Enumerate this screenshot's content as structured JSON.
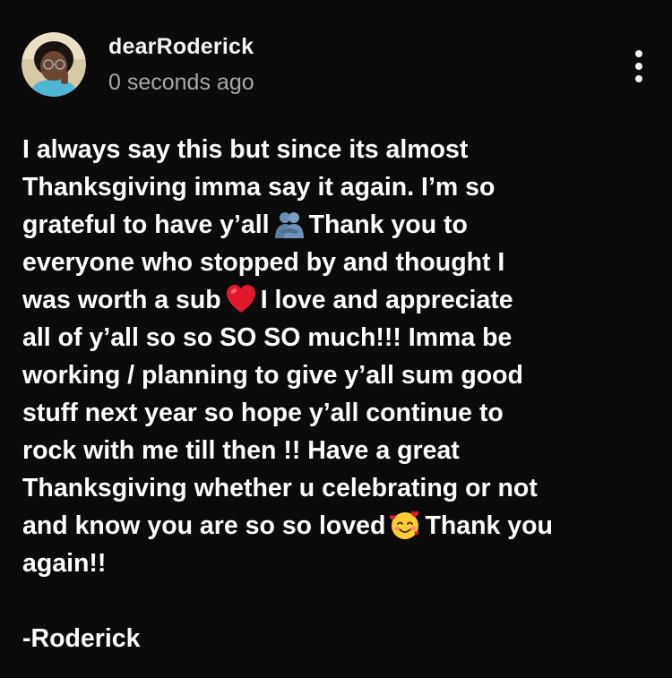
{
  "post": {
    "author_name": "dearRoderick",
    "timestamp": "0 seconds ago",
    "avatar_icon": "avatar",
    "more_icon": "more-vertical-icon",
    "lines": [
      "I always say this but since its almost",
      "Thanksgiving imma say it again. I’m so",
      "grateful to have y’all",
      "Thank you to",
      "everyone who stopped by and thought I",
      "was worth a sub",
      "I love and appreciate",
      "all of y’all so so SO SO much!!! Imma be",
      "working / planning to give y’all sum good",
      "stuff next year so hope y’all continue to",
      "rock with me till then !! Have a great",
      "Thanksgiving whether u celebrating or not",
      "and know you are so so loved",
      "Thank you",
      "again!!",
      "-Roderick"
    ],
    "emojis": [
      "people-hugging-emoji",
      "red-heart-emoji",
      "smiling-face-with-hearts-emoji"
    ]
  },
  "colors": {
    "background": "#0b0b0b",
    "text": "#ffffff",
    "secondary_text": "#a8a8a8"
  }
}
